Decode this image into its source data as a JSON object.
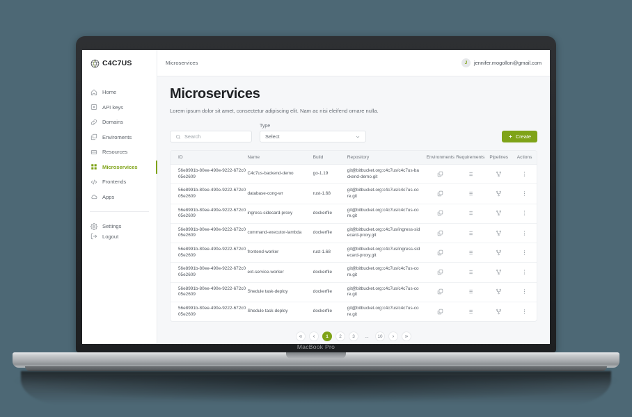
{
  "device": {
    "label": "MacBook Pro"
  },
  "theme": {
    "background": "#4d6875",
    "accent": "#7fa318",
    "surface": "#ffffff",
    "page_bg": "#f6f7f9"
  },
  "sidebar": {
    "brand": "C4C7US",
    "items": [
      {
        "label": "Home",
        "icon": "home-icon",
        "active": false
      },
      {
        "label": "API keys",
        "icon": "key-card-icon",
        "active": false
      },
      {
        "label": "Domains",
        "icon": "link-icon",
        "active": false
      },
      {
        "label": "Enviroments",
        "icon": "layers-icon",
        "active": false
      },
      {
        "label": "Resources",
        "icon": "database-icon",
        "active": false
      },
      {
        "label": "Microservices",
        "icon": "grid-icon",
        "active": true
      },
      {
        "label": "Frontends",
        "icon": "code-icon",
        "active": false
      },
      {
        "label": "Apps",
        "icon": "cloud-icon",
        "active": false
      }
    ],
    "bottom_items": [
      {
        "label": "Settings",
        "icon": "gear-icon"
      },
      {
        "label": "Logout",
        "icon": "logout-icon"
      }
    ]
  },
  "topbar": {
    "breadcrumb": "Microservices",
    "user_initial": "J",
    "user_email": "jennifer.mogollon@gmail.com"
  },
  "page": {
    "title": "Microservices",
    "subtitle": "Lorem ipsum dolor sit amet, consectetur adipiscing elit. Nam ac nisi eleifend ornare nulla."
  },
  "controls": {
    "search_placeholder": "Search",
    "search_value": "",
    "type_label": "Type",
    "type_value": "Select",
    "create_label": "Create",
    "create_icon": "plus-icon"
  },
  "table": {
    "columns": [
      "ID",
      "Name",
      "Build",
      "Repository",
      "Environments",
      "Requirements",
      "Pipelines",
      "Actions"
    ],
    "row_icons": {
      "environments": "layers-icon",
      "requirements": "list-icon",
      "pipelines": "git-branch-icon",
      "actions": "more-vertical-icon"
    },
    "rows": [
      {
        "id": "56e8991b-80ee-490e-9222-672c005e2609",
        "name": "C4c7us-backend-demo",
        "build": "go-1.19",
        "repository": "git@bitbucket.org:c4c7us/c4c7us-backend-demo.git"
      },
      {
        "id": "56e8991b-80ee-490e-9222-672c005e2609",
        "name": "database-cong-wr",
        "build": "rust-1.68",
        "repository": "git@bitbucket.org:c4c7us/c4c7us-core.git"
      },
      {
        "id": "56e8991b-80ee-490e-9222-672c005e2609",
        "name": "ingress-sidecard-proxy",
        "build": "dockerfile",
        "repository": "git@bitbucket.org:c4c7us/c4c7us-core.git"
      },
      {
        "id": "56e8991b-80ee-490e-9222-672c005e2609",
        "name": "command-executor-lambda",
        "build": "dockerfile",
        "repository": "git@bitbucket.org:c4c7us/ingress-sidecard-proxy.git"
      },
      {
        "id": "56e8991b-80ee-490e-9222-672c005e2609",
        "name": "frontend-worker",
        "build": "rust-1.68",
        "repository": "git@bitbucket.org:c4c7us/ingress-sidecard-proxy.git"
      },
      {
        "id": "56e8991b-80ee-490e-9222-672c005e2609",
        "name": "ext-service-worker",
        "build": "dockerfile",
        "repository": "git@bitbucket.org:c4c7us/c4c7us-core.git"
      },
      {
        "id": "56e8991b-80ee-490e-9222-672c005e2609",
        "name": "Shedule task-deploy",
        "build": "dockerfile",
        "repository": "git@bitbucket.org:c4c7us/c4c7us-core.git"
      },
      {
        "id": "56e8991b-80ee-490e-9222-672c005e2609",
        "name": "Shedule task-deploy",
        "build": "dockerfile",
        "repository": "git@bitbucket.org:c4c7us/c4c7us-core.git"
      }
    ]
  },
  "pagination": {
    "first_icon": "chevrons-left-icon",
    "prev_icon": "chevron-left-icon",
    "next_icon": "chevron-right-icon",
    "last_icon": "chevrons-right-icon",
    "pages": [
      "1",
      "2",
      "3",
      "...",
      "10"
    ],
    "current": "1"
  }
}
